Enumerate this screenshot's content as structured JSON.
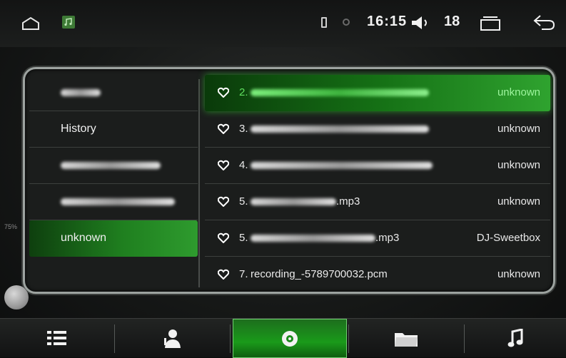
{
  "status_bar": {
    "time": "16:15",
    "volume": "18",
    "icons": [
      "home-icon",
      "app-icon",
      "sim-icon",
      "gps-icon",
      "volume-icon",
      "recents-icon",
      "back-icon"
    ]
  },
  "left_list": {
    "items": [
      {
        "label": "",
        "blurred": true,
        "blur_width": 56
      },
      {
        "label": "History",
        "blurred": false
      },
      {
        "label": "",
        "blurred": true,
        "blur_width": 140
      },
      {
        "label": "",
        "blurred": true,
        "blur_width": 160
      },
      {
        "label": "unknown",
        "blurred": false,
        "active": true
      }
    ]
  },
  "tracks": [
    {
      "num": "2.",
      "title": "",
      "title_blurred": true,
      "artist": "unknown",
      "active": true
    },
    {
      "num": "3.",
      "title": "",
      "title_blurred": true,
      "artist": "unknown"
    },
    {
      "num": "4.",
      "title": "",
      "title_blurred": true,
      "artist": "unknown"
    },
    {
      "num": "5.",
      "title": ".mp3",
      "title_blurred": true,
      "artist": "unknown"
    },
    {
      "num": "5.",
      "title": ".mp3",
      "title_blurred": true,
      "artist": "DJ-Sweetbox"
    },
    {
      "num": "7.",
      "title": "recording_-5789700032.pcm",
      "title_blurred": false,
      "artist": "unknown"
    }
  ],
  "scroll_label": "75%",
  "tabs": [
    {
      "name": "playlist-icon",
      "active": false
    },
    {
      "name": "artist-icon",
      "active": false
    },
    {
      "name": "album-icon",
      "active": true
    },
    {
      "name": "folder-icon",
      "active": false
    },
    {
      "name": "music-note-icon",
      "active": false
    }
  ],
  "colors": {
    "accent": "#1f8f1f",
    "accent_bright": "#2fa32f",
    "frame": "#9da3a0"
  }
}
